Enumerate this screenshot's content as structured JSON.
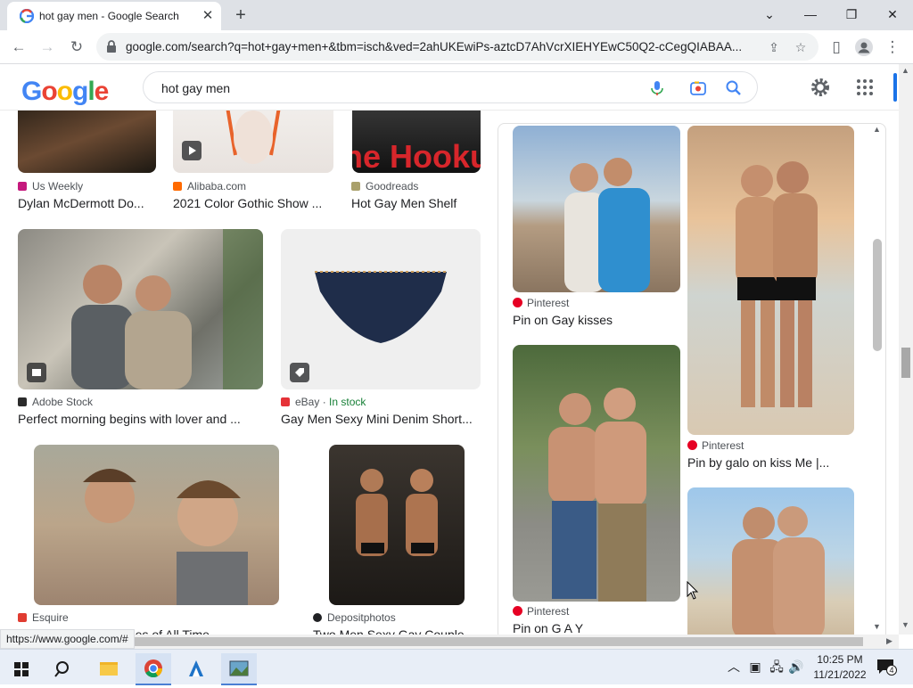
{
  "browser": {
    "tab_title": "hot gay men - Google Search",
    "close_tab_glyph": "✕",
    "new_tab_glyph": "+",
    "url": "google.com/search?q=hot+gay+men+&tbm=isch&ved=2ahUKEwiPs-aztcD7AhVcrXIEHYEwC50Q2-cCegQIABAA...",
    "status_url": "https://www.google.com/#"
  },
  "search": {
    "query": "hot gay men",
    "logo": "Google"
  },
  "colors": {
    "accent": "#1a73e8",
    "pinterest": "#e60023",
    "in_stock": "#188038"
  },
  "results": [
    {
      "source": "Us Weekly",
      "caption": "Dylan McDermott Do...",
      "icon_color": "#c5197d"
    },
    {
      "source": "Alibaba.com",
      "caption": "2021 Color Gothic Show ...",
      "icon_color": "#ff6a00"
    },
    {
      "source": "Goodreads",
      "caption": "Hot Gay Men Shelf",
      "icon_color": "#a9a06b",
      "image_text": "The Hookup"
    },
    {
      "source": "Adobe Stock",
      "caption": "Perfect morning begins with lover and ...",
      "icon_color": "#2b2b2b"
    },
    {
      "source": "eBay",
      "stock": "In stock",
      "caption": "Gay Men Sexy Mini Denim Short...",
      "icon_color": "#e53238"
    },
    {
      "source": "Esquire",
      "caption": "...es of All Time",
      "icon_color": "#e03c31"
    },
    {
      "source": "Depositphotos",
      "caption": "Two Men Sexy Gay Couple",
      "icon_color": "#202124"
    }
  ],
  "panel": [
    {
      "source": "Pinterest",
      "caption": "Pin on Gay kisses"
    },
    {
      "source": "Pinterest",
      "caption": "Pin by galo on kiss Me |..."
    },
    {
      "source": "Pinterest",
      "caption": "Pin on G A Y"
    }
  ],
  "taskbar": {
    "time": "10:25 PM",
    "date": "11/21/2022",
    "notifications": "4"
  }
}
